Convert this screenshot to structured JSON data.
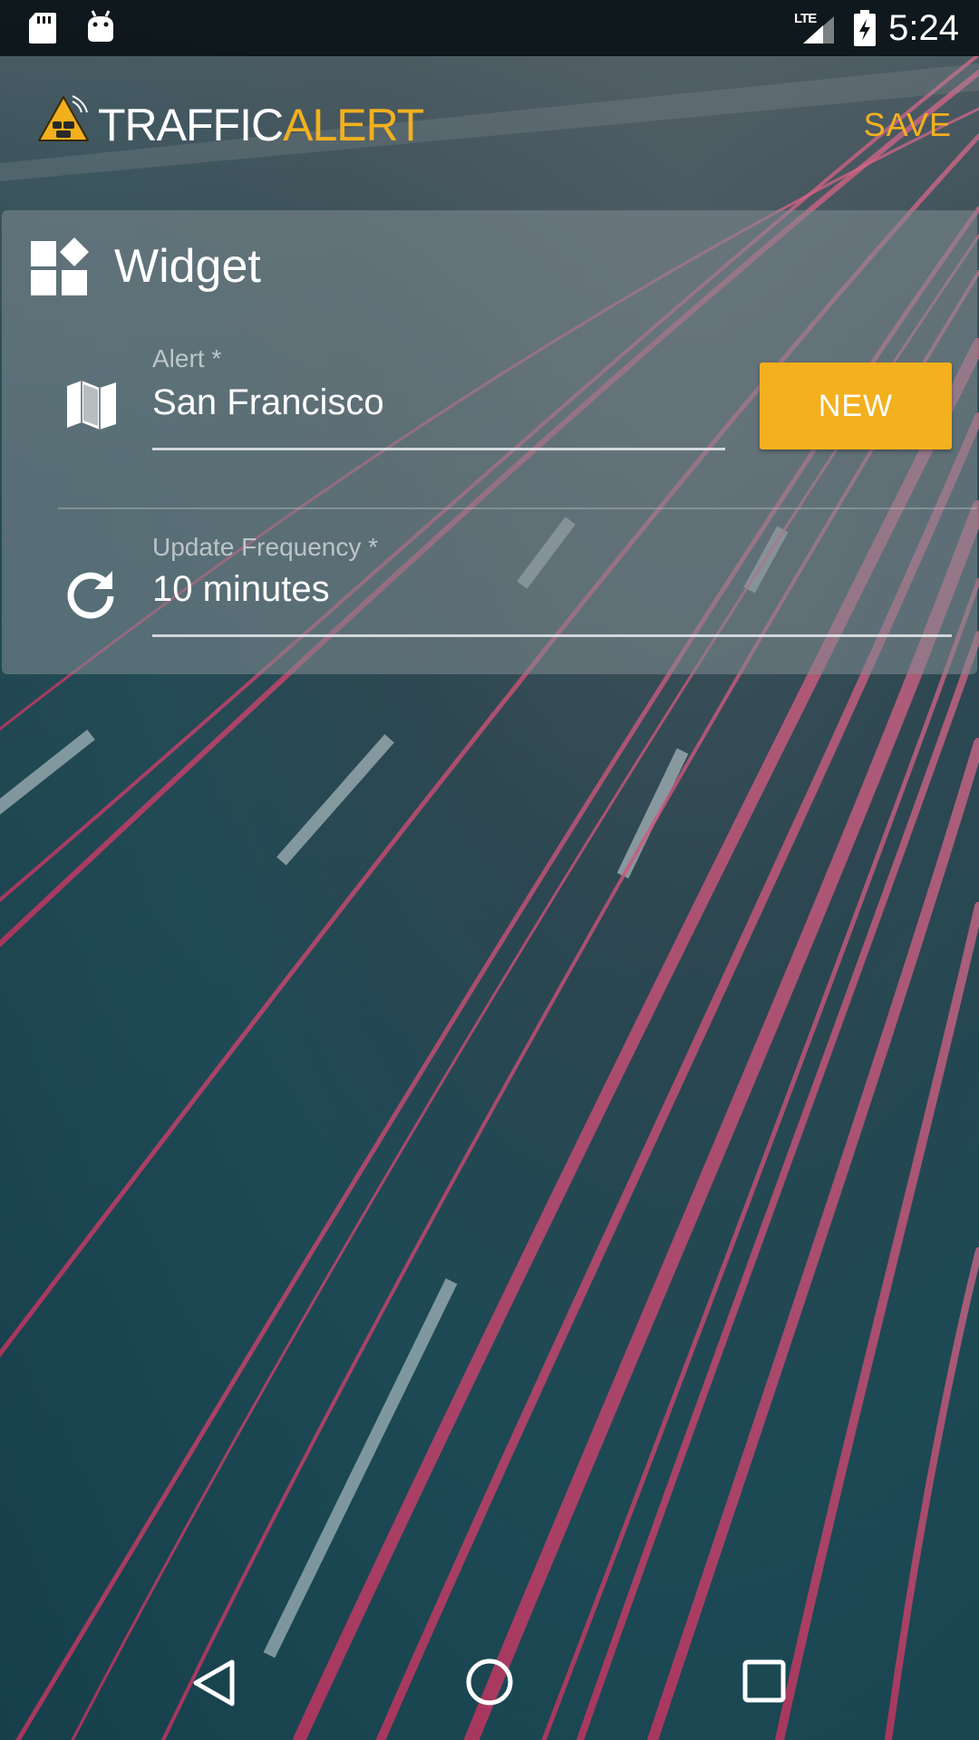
{
  "status_bar": {
    "time": "5:24",
    "network": "LTE",
    "icons": [
      "sd-card-icon",
      "android-debug-icon",
      "lte-signal-icon",
      "battery-charging-icon"
    ]
  },
  "app_bar": {
    "logo_part1": "TRAFFIC",
    "logo_part2": "ALERT",
    "save_label": "SAVE",
    "accent_color": "#f2b01e"
  },
  "card": {
    "title": "Widget",
    "alert_field": {
      "label": "Alert *",
      "value": "San Francisco"
    },
    "new_button_label": "NEW",
    "frequency_field": {
      "label": "Update Frequency *",
      "value": "10 minutes"
    }
  },
  "nav_bar": {
    "buttons": [
      "back-icon",
      "home-icon",
      "recents-icon"
    ]
  }
}
